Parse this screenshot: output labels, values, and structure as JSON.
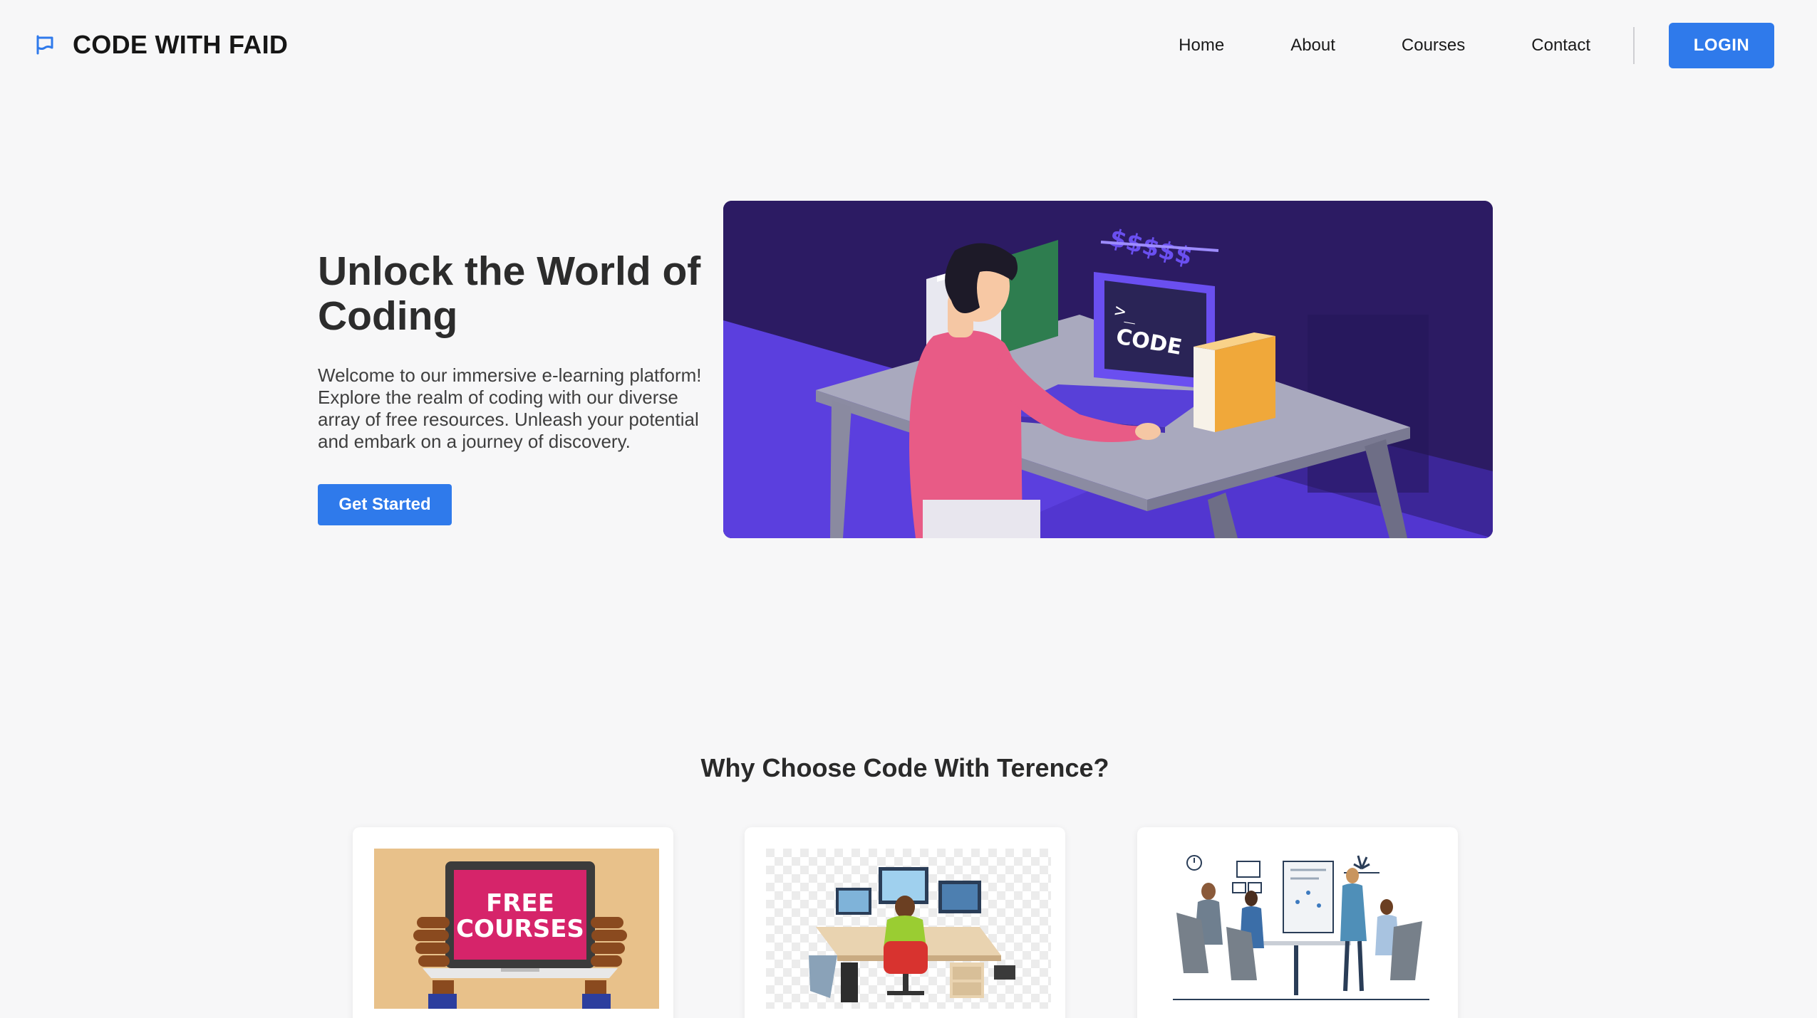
{
  "header": {
    "brand": "CODE WITH FAID",
    "brand_icon": "flag-icon",
    "nav": [
      "Home",
      "About",
      "Courses",
      "Contact"
    ],
    "login_label": "LOGIN"
  },
  "hero": {
    "title": "Unlock the World of Coding",
    "description": "Welcome to our immersive e-learning platform! Explore the realm of coding with our diverse array of free resources. Unleash your potential and embark on a journey of discovery.",
    "cta_label": "Get Started",
    "illustration": {
      "laptop_text": ">_",
      "laptop_label": "CODE",
      "money_signs": "$$$$$"
    }
  },
  "why": {
    "title": "Why Choose Code With Terence?",
    "cards": [
      {
        "illustration_text": "FREE COURSES",
        "line1": "FREE",
        "line2": "COURSES"
      },
      {
        "illustration_text": ""
      },
      {
        "illustration_text": ""
      }
    ]
  },
  "colors": {
    "accent": "#2f7aeb",
    "background": "#f7f7f8",
    "hero_bg": "#2c1b63",
    "hero_floor": "#5d3fe0"
  }
}
